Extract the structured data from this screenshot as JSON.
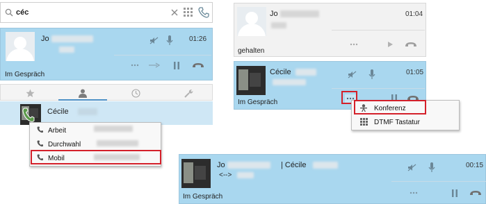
{
  "search": {
    "value": "céc"
  },
  "panel_a": {
    "call": {
      "name": "Jo",
      "time": "01:26",
      "status": "Im Gespräch"
    },
    "contact": {
      "name": "Cécile"
    },
    "phone_menu": {
      "items": [
        "Arbeit",
        "Durchwahl",
        "Mobil"
      ]
    }
  },
  "panel_b": {
    "held_call": {
      "name": "Jo",
      "time": "01:04",
      "status": "gehalten"
    },
    "active_call": {
      "name": "Cécile",
      "time": "01:05",
      "status": "Im Gespräch"
    },
    "more_menu": {
      "items": [
        "Konferenz",
        "DTMF Tastatur"
      ]
    }
  },
  "panel_c": {
    "conference": {
      "name": "Jo",
      "name2": "| Cécile",
      "arrows": "<-->",
      "time": "00:15",
      "status": "Im Gespräch"
    }
  },
  "colors": {
    "call_blue": "#a9d7ef",
    "highlight_red": "#d4202a",
    "hangup_grey": "#707070"
  }
}
